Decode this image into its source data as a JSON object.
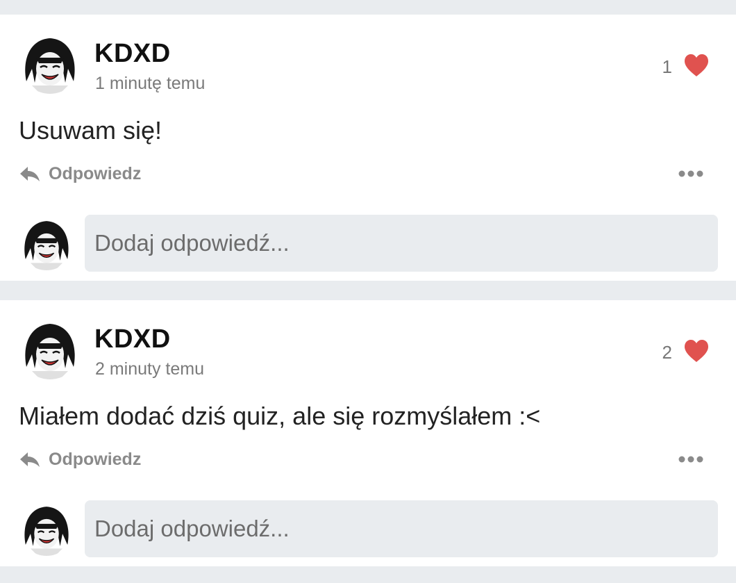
{
  "colors": {
    "page_background": "#e9ecef",
    "card_background": "#ffffff",
    "heart": "#e0524f",
    "muted_text": "#8a8a8a",
    "input_background": "#e9ecef"
  },
  "posts": [
    {
      "author": "KDXD",
      "timestamp": "1 minutę temu",
      "likes": "1",
      "text": "Usuwam się!",
      "reply_label": "Odpowiedz",
      "reply_placeholder": "Dodaj odpowiedź...",
      "icons": [
        "avatar",
        "heart-icon",
        "reply-arrow-icon",
        "more-dots-icon"
      ]
    },
    {
      "author": "KDXD",
      "timestamp": "2 minuty temu",
      "likes": "2",
      "text": "Miałem dodać dziś quiz, ale się rozmyślałem :<",
      "reply_label": "Odpowiedz",
      "reply_placeholder": "Dodaj odpowiedź...",
      "icons": [
        "avatar",
        "heart-icon",
        "reply-arrow-icon",
        "more-dots-icon"
      ]
    }
  ]
}
